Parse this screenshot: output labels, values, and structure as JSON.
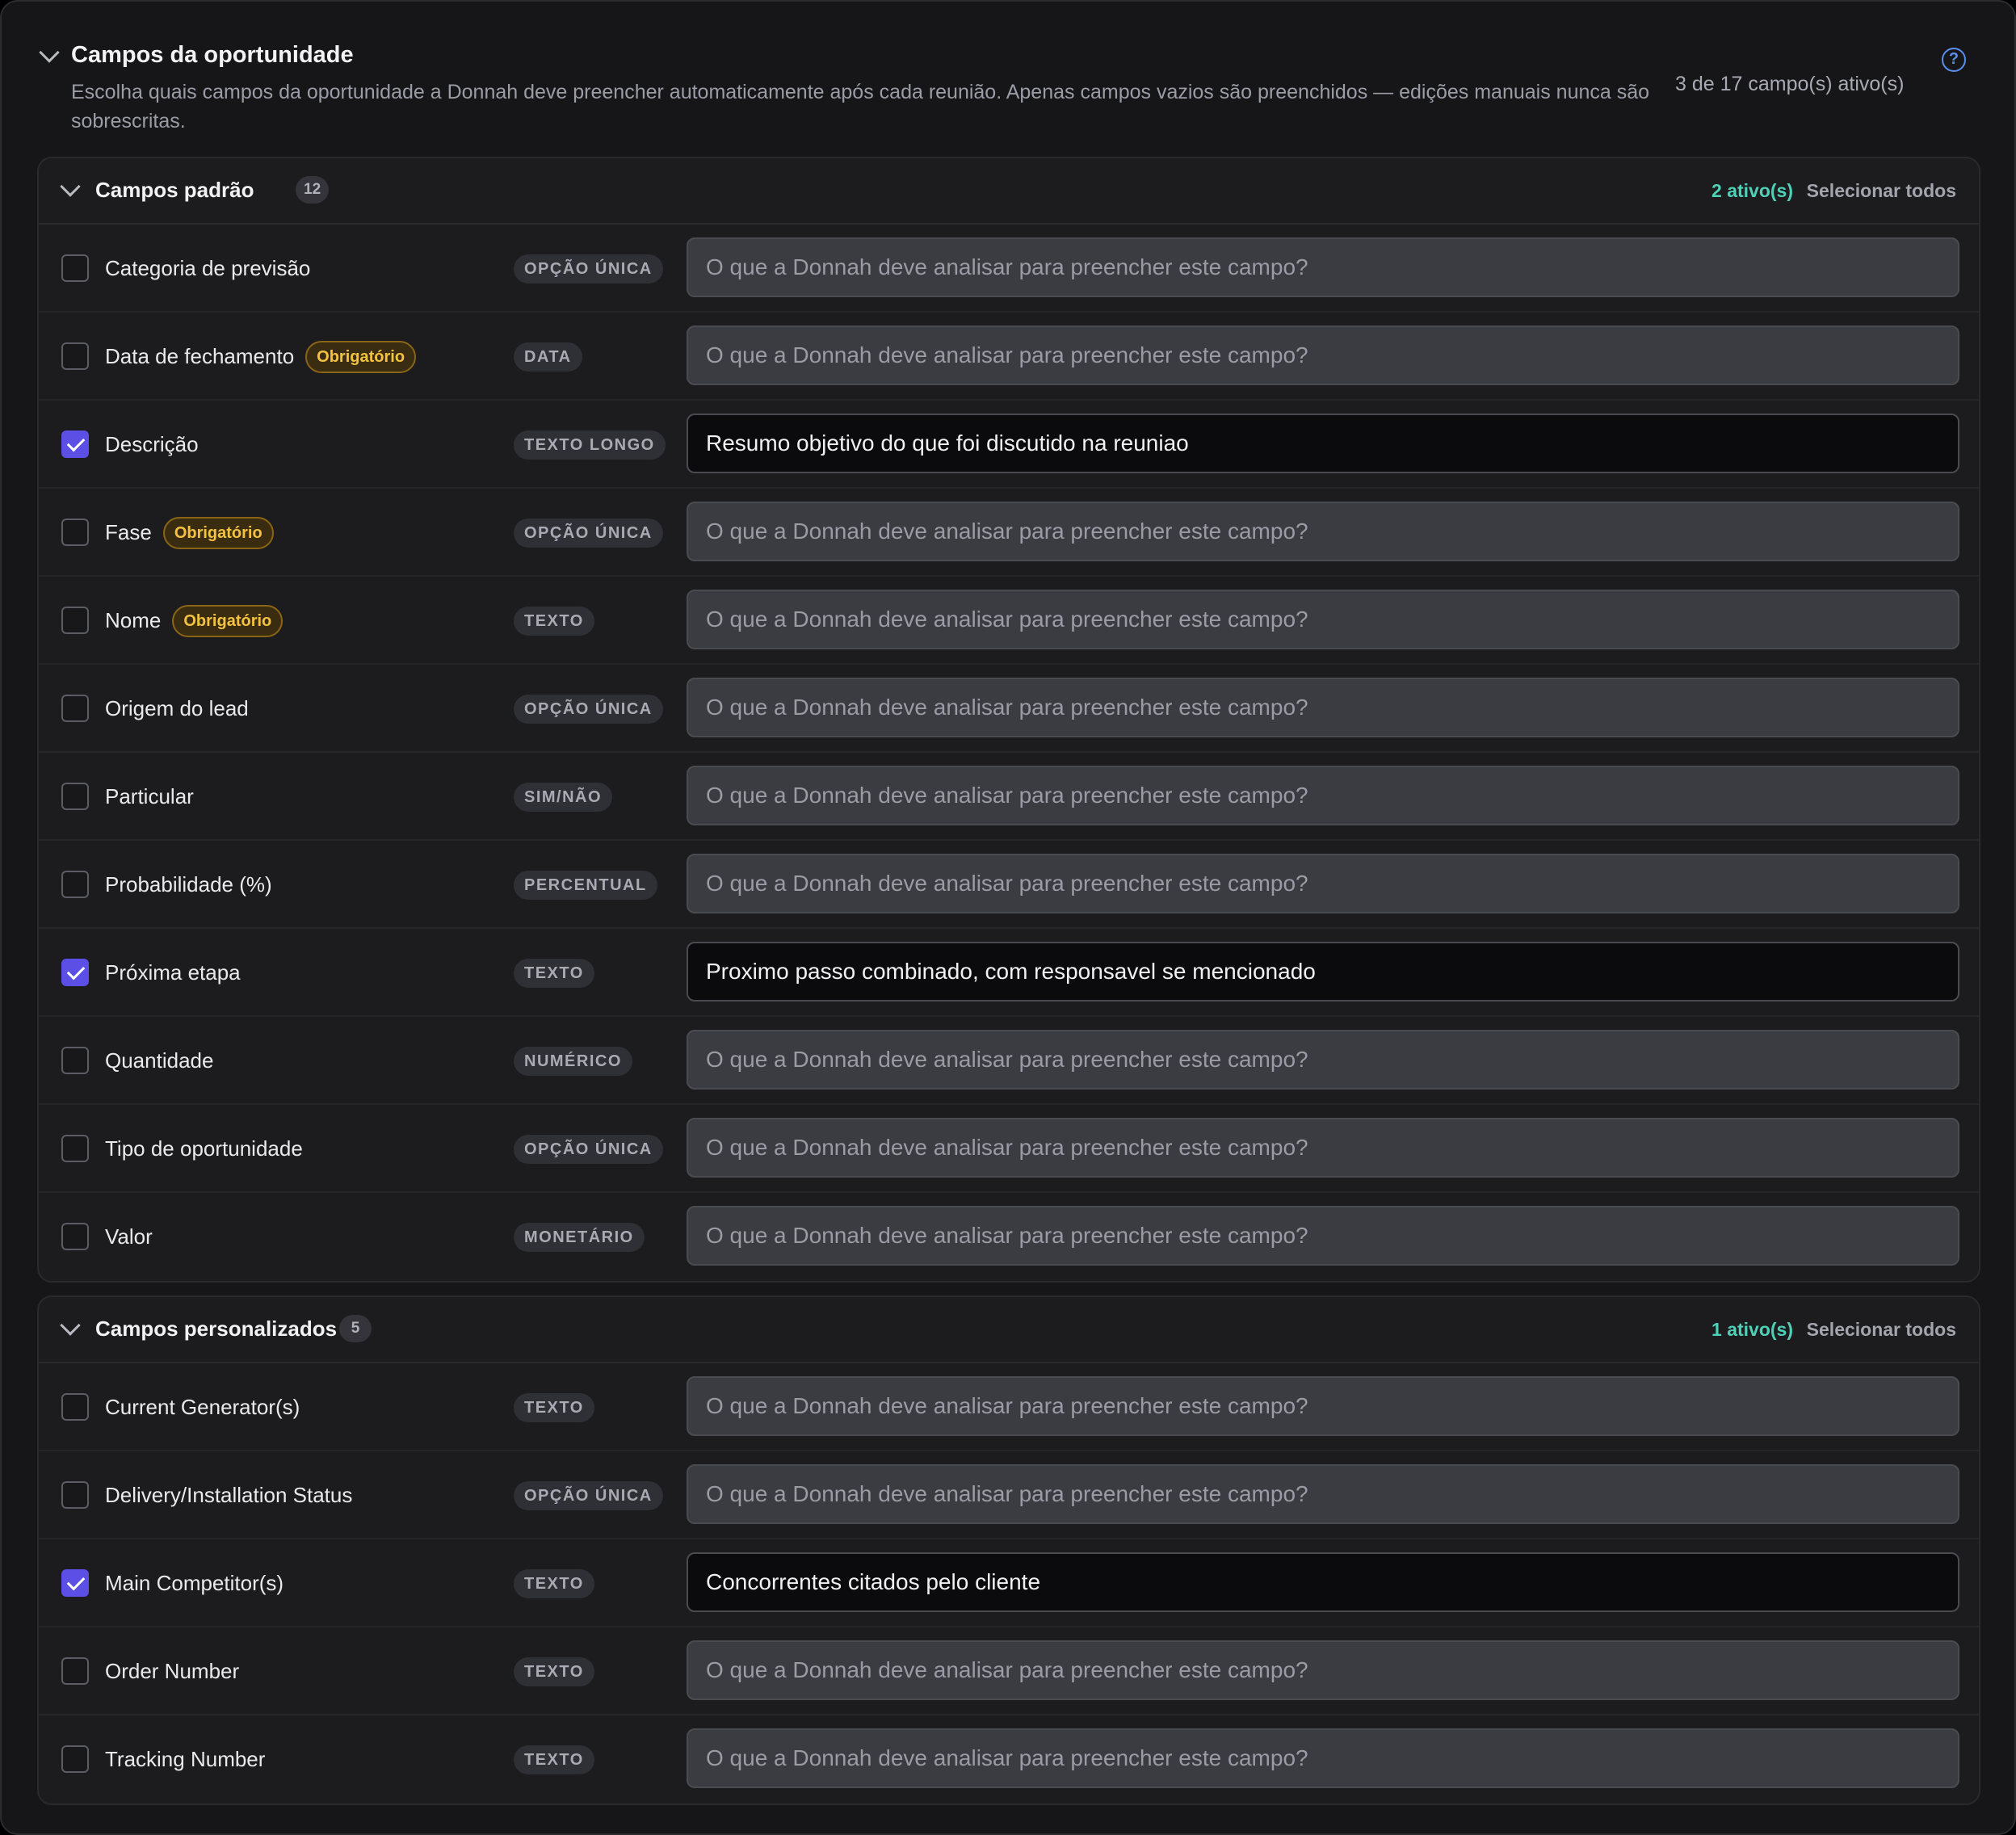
{
  "header": {
    "title": "Campos da oportunidade",
    "description": "Escolha quais campos da oportunidade a Donnah deve preencher automaticamente após cada reunião. Apenas campos vazios são preenchidos — edições manuais nunca são sobrescritas.",
    "active_summary": "3 de 17 campo(s) ativo(s)",
    "help_icon": "?"
  },
  "prompt_placeholder": "O que a Donnah deve analisar para preencher este campo?",
  "sections": [
    {
      "title": "Campos padrão",
      "count": "12",
      "active_count": "2 ativo(s)",
      "select_all_label": "Selecionar todos",
      "fields": [
        {
          "label": "Categoria de previsão",
          "type": "OPÇÃO ÚNICA",
          "required": "",
          "checked": false,
          "value": ""
        },
        {
          "label": "Data de fechamento",
          "type": "DATA",
          "required": "Obrigatório",
          "checked": false,
          "value": ""
        },
        {
          "label": "Descrição",
          "type": "TEXTO LONGO",
          "required": "",
          "checked": true,
          "value": "Resumo objetivo do que foi discutido na reuniao"
        },
        {
          "label": "Fase",
          "type": "OPÇÃO ÚNICA",
          "required": "Obrigatório",
          "checked": false,
          "value": ""
        },
        {
          "label": "Nome",
          "type": "TEXTO",
          "required": "Obrigatório",
          "checked": false,
          "value": ""
        },
        {
          "label": "Origem do lead",
          "type": "OPÇÃO ÚNICA",
          "required": "",
          "checked": false,
          "value": ""
        },
        {
          "label": "Particular",
          "type": "SIM/NÃO",
          "required": "",
          "checked": false,
          "value": ""
        },
        {
          "label": "Probabilidade (%)",
          "type": "PERCENTUAL",
          "required": "",
          "checked": false,
          "value": ""
        },
        {
          "label": "Próxima etapa",
          "type": "TEXTO",
          "required": "",
          "checked": true,
          "value": "Proximo passo combinado, com responsavel se mencionado"
        },
        {
          "label": "Quantidade",
          "type": "NUMÉRICO",
          "required": "",
          "checked": false,
          "value": ""
        },
        {
          "label": "Tipo de oportunidade",
          "type": "OPÇÃO ÚNICA",
          "required": "",
          "checked": false,
          "value": ""
        },
        {
          "label": "Valor",
          "type": "MONETÁRIO",
          "required": "",
          "checked": false,
          "value": ""
        }
      ]
    },
    {
      "title": "Campos personalizados",
      "count": "5",
      "active_count": "1 ativo(s)",
      "select_all_label": "Selecionar todos",
      "fields": [
        {
          "label": "Current Generator(s)",
          "type": "TEXTO",
          "required": "",
          "checked": false,
          "value": ""
        },
        {
          "label": "Delivery/Installation Status",
          "type": "OPÇÃO ÚNICA",
          "required": "",
          "checked": false,
          "value": ""
        },
        {
          "label": "Main Competitor(s)",
          "type": "TEXTO",
          "required": "",
          "checked": true,
          "value": "Concorrentes citados pelo cliente"
        },
        {
          "label": "Order Number",
          "type": "TEXTO",
          "required": "",
          "checked": false,
          "value": ""
        },
        {
          "label": "Tracking Number",
          "type": "TEXTO",
          "required": "",
          "checked": false,
          "value": ""
        }
      ]
    }
  ],
  "colors": {
    "accent": "#5b4fe6",
    "active_text": "#4fd1b8",
    "required_text": "#f3c241",
    "help_icon": "#5a8ff0"
  }
}
